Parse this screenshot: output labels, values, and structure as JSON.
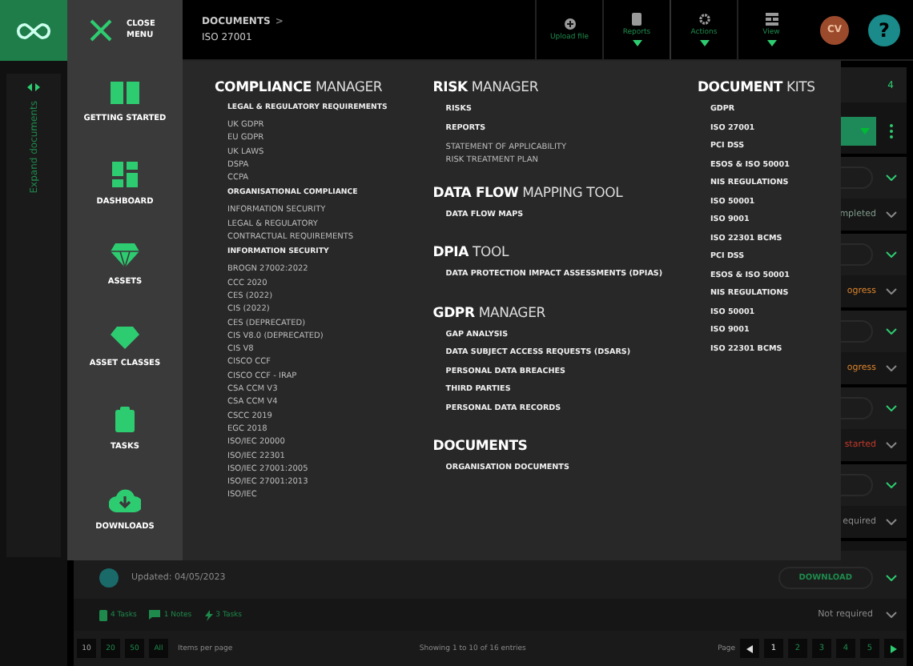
{
  "rail": {
    "label": "Expand documents"
  },
  "close_menu": {
    "label": "CLOSE MENU"
  },
  "breadcrumb": {
    "parent": "DOCUMENTS",
    "separator": ">",
    "current": "ISO 27001"
  },
  "toolbar": [
    {
      "label": "Upload file",
      "kind": "upload",
      "dropdown": false
    },
    {
      "label": "Reports",
      "kind": "reports",
      "dropdown": true
    },
    {
      "label": "Actions",
      "kind": "actions",
      "dropdown": true
    },
    {
      "label": "View",
      "kind": "view",
      "dropdown": true
    }
  ],
  "avatar": {
    "initials": "CV"
  },
  "help": {
    "label": "?"
  },
  "nav": [
    {
      "label": "GETTING STARTED",
      "kind": "book"
    },
    {
      "label": "DASHBOARD",
      "kind": "dashboard"
    },
    {
      "label": "ASSETS",
      "kind": "gem"
    },
    {
      "label": "ASSET CLASSES",
      "kind": "diamond"
    },
    {
      "label": "TASKS",
      "kind": "clipboard"
    },
    {
      "label": "DOWNLOADS",
      "kind": "download"
    }
  ],
  "menu_columns": [
    [
      {
        "heading": "**COMPLIANCE** MANAGER",
        "entries": [
          {
            "kind": "group",
            "label": "LEGAL & REGULATORY REQUIREMENTS"
          },
          {
            "kind": "item",
            "label": "UK GDPR"
          },
          {
            "kind": "item",
            "label": "EU GDPR"
          },
          {
            "kind": "item",
            "label": "UK LAWS"
          },
          {
            "kind": "item",
            "label": "DSPA"
          },
          {
            "kind": "item",
            "label": "CCPA"
          },
          {
            "kind": "group",
            "label": "ORGANISATIONAL COMPLIANCE"
          },
          {
            "kind": "item",
            "label": "INFORMATION SECURITY"
          },
          {
            "kind": "item",
            "label": "LEGAL & REGULATORY"
          },
          {
            "kind": "item",
            "label": "CONTRACTUAL REQUIREMENTS"
          },
          {
            "kind": "group",
            "label": "INFORMATION SECURITY"
          },
          {
            "kind": "item",
            "label": "BROGN 27002:2022"
          },
          {
            "kind": "item",
            "label": "CCC 2020"
          },
          {
            "kind": "item",
            "label": "CES (2022)"
          },
          {
            "kind": "item",
            "label": "CIS (2022)"
          },
          {
            "kind": "item",
            "label": "CES (DEPRECATED)"
          },
          {
            "kind": "item",
            "label": "CIS V8.0 (DEPRECATED)"
          },
          {
            "kind": "item",
            "label": "CIS V8"
          },
          {
            "kind": "item",
            "label": "CISCO CCF"
          },
          {
            "kind": "item",
            "label": "CISCO CCF - IRAP"
          },
          {
            "kind": "item",
            "label": "CSA CCM V3"
          },
          {
            "kind": "item",
            "label": "CSA CCM V4"
          },
          {
            "kind": "item",
            "label": "CSCC 2019"
          },
          {
            "kind": "item",
            "label": "EGC 2018"
          },
          {
            "kind": "item",
            "label": "ISO/IEC 20000"
          },
          {
            "kind": "item",
            "label": "ISO/IEC 22301"
          },
          {
            "kind": "item",
            "label": "ISO/IEC 27001:2005"
          },
          {
            "kind": "item",
            "label": "ISO/IEC 27001:2013"
          },
          {
            "kind": "item",
            "label": "ISO/IEC"
          }
        ]
      }
    ],
    [
      {
        "heading": "**RISK** MANAGER",
        "entries": [
          {
            "kind": "link",
            "label": "RISKS"
          },
          {
            "kind": "link",
            "label": "REPORTS"
          },
          {
            "kind": "item",
            "label": "STATEMENT OF APPLICABILITY"
          },
          {
            "kind": "item",
            "label": "RISK TREATMENT PLAN"
          }
        ]
      },
      {
        "heading": "**DATA FLOW** MAPPING TOOL",
        "entries": [
          {
            "kind": "link",
            "label": "DATA FLOW MAPS"
          }
        ]
      },
      {
        "heading": "**DPIA** TOOL",
        "entries": [
          {
            "kind": "link",
            "label": "DATA PROTECTION IMPACT ASSESSMENTS (DPIAS)"
          }
        ]
      },
      {
        "heading": "**GDPR** MANAGER",
        "entries": [
          {
            "kind": "link",
            "label": "GAP ANALYSIS"
          },
          {
            "kind": "link",
            "label": "DATA SUBJECT ACCESS REQUESTS (DSARS)"
          },
          {
            "kind": "link",
            "label": "PERSONAL DATA BREACHES"
          },
          {
            "kind": "link",
            "label": "THIRD PARTIES"
          },
          {
            "kind": "link",
            "label": "PERSONAL DATA RECORDS"
          }
        ]
      },
      {
        "heading": "**DOCUMENTS**",
        "entries": [
          {
            "kind": "link",
            "label": "ORGANISATION DOCUMENTS"
          }
        ]
      }
    ],
    [
      {
        "heading": "**DOCUMENT** KITS",
        "entries": [
          {
            "kind": "link",
            "label": "GDPR"
          },
          {
            "kind": "link",
            "label": "ISO 27001"
          },
          {
            "kind": "link",
            "label": "PCI DSS"
          },
          {
            "kind": "link",
            "label": "ESOS & ISO 50001"
          },
          {
            "kind": "link",
            "label": "NIS REGULATIONS"
          },
          {
            "kind": "link",
            "label": "ISO 50001"
          },
          {
            "kind": "link",
            "label": "ISO 9001"
          },
          {
            "kind": "link",
            "label": "ISO 22301 BCMS"
          },
          {
            "kind": "link",
            "label": "PCI DSS"
          },
          {
            "kind": "link",
            "label": "ESOS & ISO 50001"
          },
          {
            "kind": "link",
            "label": "NIS REGULATIONS"
          },
          {
            "kind": "link",
            "label": "ISO 50001"
          },
          {
            "kind": "link",
            "label": "ISO 9001"
          },
          {
            "kind": "link",
            "label": "ISO 22301 BCMS"
          }
        ]
      }
    ]
  ],
  "document_count": "4",
  "statuses": [
    {
      "label": "mpleted",
      "color": "#7f9a8a"
    },
    {
      "label": "ogress",
      "color": "#d9822b"
    },
    {
      "label": "ogress",
      "color": "#d9822b"
    },
    {
      "label": "started",
      "color": "#c0392b"
    },
    {
      "label": "equired",
      "color": "#8a8a8a"
    }
  ],
  "last_row": {
    "updated": "Updated: 04/05/2023",
    "action": "DOWNLOAD",
    "status": "Not required",
    "meta": [
      {
        "kind": "tasks",
        "label": "4 Tasks"
      },
      {
        "kind": "notes",
        "label": "1 Notes"
      },
      {
        "kind": "actions",
        "label": "3 Tasks"
      }
    ]
  },
  "pagination": {
    "per_page": [
      {
        "label": "10",
        "selected": true
      },
      {
        "label": "20",
        "selected": false
      },
      {
        "label": "50",
        "selected": false
      },
      {
        "label": "All",
        "selected": false
      }
    ],
    "per_page_label": "Items per page",
    "summary": "Showing 1 to 10 of 16 entries",
    "page_label": "Page",
    "pages": [
      {
        "label": "1",
        "selected": true
      },
      {
        "label": "2",
        "selected": false
      },
      {
        "label": "3",
        "selected": false
      },
      {
        "label": "4",
        "selected": false
      },
      {
        "label": "5",
        "selected": false
      }
    ]
  }
}
